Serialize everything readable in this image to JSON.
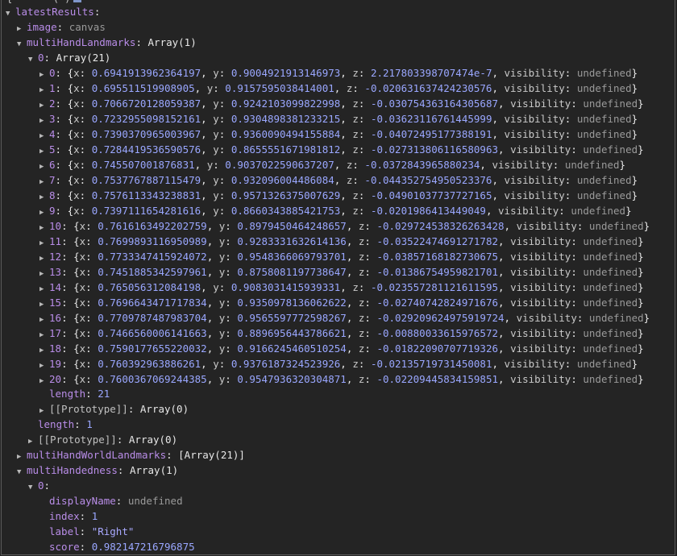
{
  "top_fragment": "{ · · · (·)",
  "root": {
    "key": "latestResults",
    "sep": ":"
  },
  "image": {
    "key": "image",
    "value": "canvas"
  },
  "multiHandLandmarks": {
    "key": "multiHandLandmarks",
    "summary": "Array(1)"
  },
  "lm_array": {
    "key": "0",
    "summary": "Array(21)"
  },
  "landmarks": [
    {
      "i": "0",
      "x": "0.6941913962364197",
      "y": "0.9004921913146973",
      "z": "2.217803398707474e-7",
      "v": "undefined"
    },
    {
      "i": "1",
      "x": "0.695511519908905",
      "y": "0.9157595038414001",
      "z": "-0.020631637424230576",
      "v": "undefined"
    },
    {
      "i": "2",
      "x": "0.7066720128059387",
      "y": "0.9242103099822998",
      "z": "-0.030754363164305687",
      "v": "undefined"
    },
    {
      "i": "3",
      "x": "0.7232955098152161",
      "y": "0.9304898381233215",
      "z": "-0.03623116761445999",
      "v": "undefined"
    },
    {
      "i": "4",
      "x": "0.7390370965003967",
      "y": "0.9360090494155884",
      "z": "-0.04072495177388191",
      "v": "undefined"
    },
    {
      "i": "5",
      "x": "0.7284419536590576",
      "y": "0.8655551671981812",
      "z": "-0.027313806116580963",
      "v": "undefined"
    },
    {
      "i": "6",
      "x": "0.745507001876831",
      "y": "0.9037022590637207",
      "z": "-0.0372843965880234",
      "v": "undefined"
    },
    {
      "i": "7",
      "x": "0.7537767887115479",
      "y": "0.932096004486084",
      "z": "-0.044352754950523376",
      "v": "undefined"
    },
    {
      "i": "8",
      "x": "0.7576113343238831",
      "y": "0.9571326375007629",
      "z": "-0.04901037737727165",
      "v": "undefined"
    },
    {
      "i": "9",
      "x": "0.7397111654281616",
      "y": "0.8660343885421753",
      "z": "-0.0201986413449049",
      "v": "undefined"
    },
    {
      "i": "10",
      "x": "0.7616163492202759",
      "y": "0.8979450464248657",
      "z": "-0.029724538326263428",
      "v": "undefined"
    },
    {
      "i": "11",
      "x": "0.7699893116950989",
      "y": "0.9283331632614136",
      "z": "-0.03522474691271782",
      "v": "undefined"
    },
    {
      "i": "12",
      "x": "0.7733347415924072",
      "y": "0.9548366069793701",
      "z": "-0.03857168182730675",
      "v": "undefined"
    },
    {
      "i": "13",
      "x": "0.7451885342597961",
      "y": "0.8758081197738647",
      "z": "-0.01386754959821701",
      "v": "undefined"
    },
    {
      "i": "14",
      "x": "0.765056312084198",
      "y": "0.9083031415939331",
      "z": "-0.023557281121611595",
      "v": "undefined"
    },
    {
      "i": "15",
      "x": "0.7696643471717834",
      "y": "0.9350978136062622",
      "z": "-0.02740742824971676",
      "v": "undefined"
    },
    {
      "i": "16",
      "x": "0.7709787487983704",
      "y": "0.9565597772598267",
      "z": "-0.029209624975919724",
      "v": "undefined"
    },
    {
      "i": "17",
      "x": "0.7466560006141663",
      "y": "0.8896956443786621",
      "z": "-0.00880033615976572",
      "v": "undefined"
    },
    {
      "i": "18",
      "x": "0.7590177655220032",
      "y": "0.9166245460510254",
      "z": "-0.01822090707719326",
      "v": "undefined"
    },
    {
      "i": "19",
      "x": "0.760392963886261",
      "y": "0.9376187324523926",
      "z": "-0.02135719731450081",
      "v": "undefined"
    },
    {
      "i": "20",
      "x": "0.7600367069244385",
      "y": "0.9547936320304871",
      "z": "-0.02209445834159851",
      "v": "undefined"
    }
  ],
  "lm_length": {
    "key": "length",
    "value": "21"
  },
  "lm_proto": {
    "key": "[[Prototype]]",
    "value": "Array(0)"
  },
  "outer_length": {
    "key": "length",
    "value": "1"
  },
  "outer_proto": {
    "key": "[[Prototype]]",
    "value": "Array(0)"
  },
  "world": {
    "key": "multiHandWorldLandmarks",
    "value": "[Array(21)]"
  },
  "handedness": {
    "key": "multiHandedness",
    "summary": "Array(1)"
  },
  "hand0": {
    "key": "0",
    "sep": ":"
  },
  "hand_fields": {
    "displayName": {
      "key": "displayName",
      "value": "undefined"
    },
    "index": {
      "key": "index",
      "value": "1"
    },
    "label": {
      "key": "label",
      "value": "\"Right\""
    },
    "score": {
      "key": "score",
      "value": "0.982147216796875"
    }
  },
  "labels": {
    "x": "x",
    "y": "y",
    "z": "z",
    "visibility": "visibility"
  }
}
